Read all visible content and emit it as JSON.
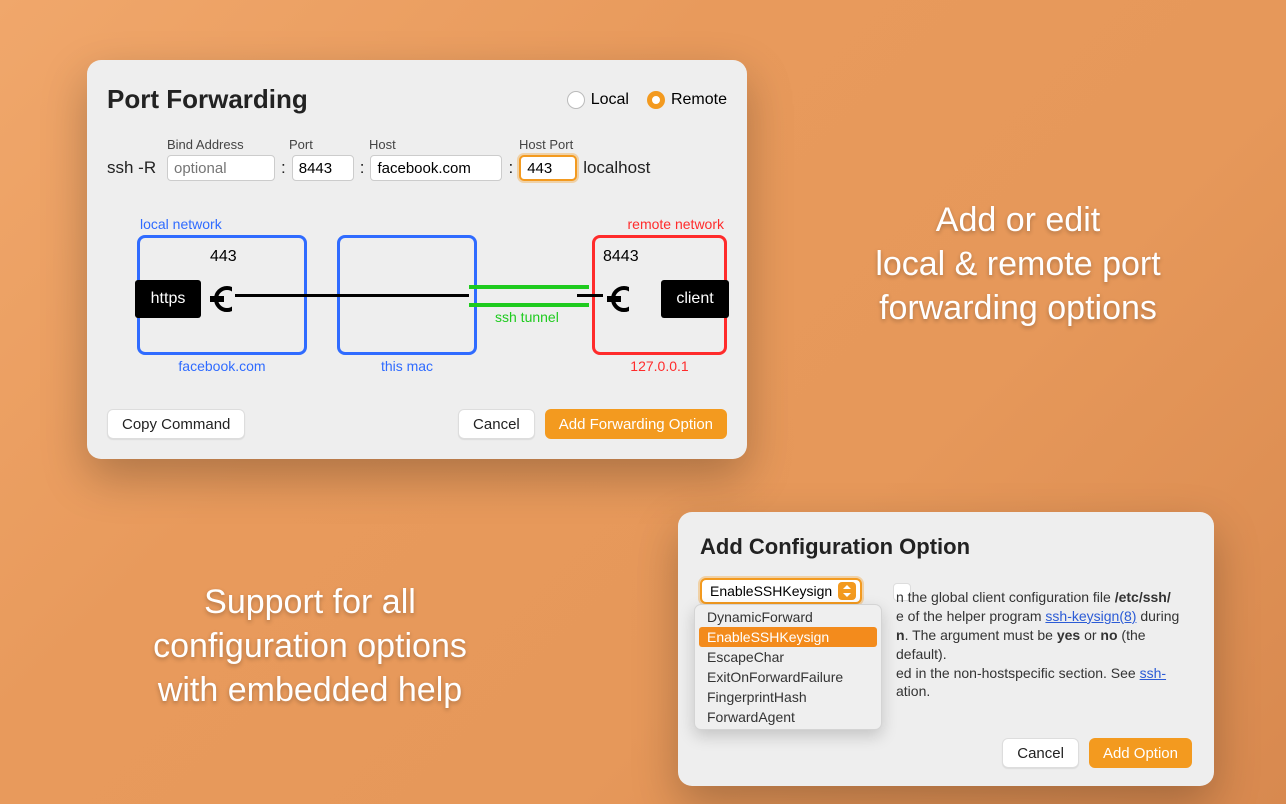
{
  "port_forwarding": {
    "title": "Port Forwarding",
    "radios": {
      "local": "Local",
      "remote": "Remote",
      "selected": "Remote"
    },
    "labels": {
      "bind_address": "Bind Address",
      "port": "Port",
      "host": "Host",
      "host_port": "Host Port"
    },
    "prefix": "ssh -R",
    "bind_address_placeholder": "optional",
    "port_value": "8443",
    "host_value": "facebook.com",
    "host_port_value": "443",
    "suffix": "localhost",
    "diagram": {
      "local_network_label": "local network",
      "remote_network_label": "remote network",
      "this_mac_label": "this mac",
      "https_label": "https",
      "client_label": "client",
      "local_port": "443",
      "remote_port": "8443",
      "facebook": "facebook.com",
      "loopback": "127.0.0.1",
      "ssh_tunnel": "ssh tunnel"
    },
    "buttons": {
      "copy": "Copy Command",
      "cancel": "Cancel",
      "add": "Add Forwarding Option"
    }
  },
  "captions": {
    "right": "Add or edit\nlocal & remote port\nforwarding options",
    "left": "Support for all\nconfiguration options\nwith embedded help"
  },
  "add_option": {
    "title": "Add Configuration Option",
    "selected": "EnableSSHKeysign",
    "dropdown_items": [
      "DynamicForward",
      "EnableSSHKeysign",
      "EscapeChar",
      "ExitOnForwardFailure",
      "FingerprintHash",
      "ForwardAgent"
    ],
    "help_prefix": "n the global client configuration file ",
    "help_path": "/etc/ssh/",
    "help_mid1": "e of the helper program ",
    "help_link1": "ssh-keysign(8)",
    "help_mid2": " during",
    "help_line3a": "n",
    "help_line3b": ". The argument must be ",
    "help_yes": "yes",
    "help_or": " or ",
    "help_no": "no",
    "help_default": " (the default).",
    "help_line4a": "ed in the non-hostspecific section. See ",
    "help_link2": "ssh-",
    "help_end": "ation.",
    "buttons": {
      "cancel": "Cancel",
      "add": "Add Option"
    }
  },
  "colors": {
    "accent": "#f39a1f"
  }
}
